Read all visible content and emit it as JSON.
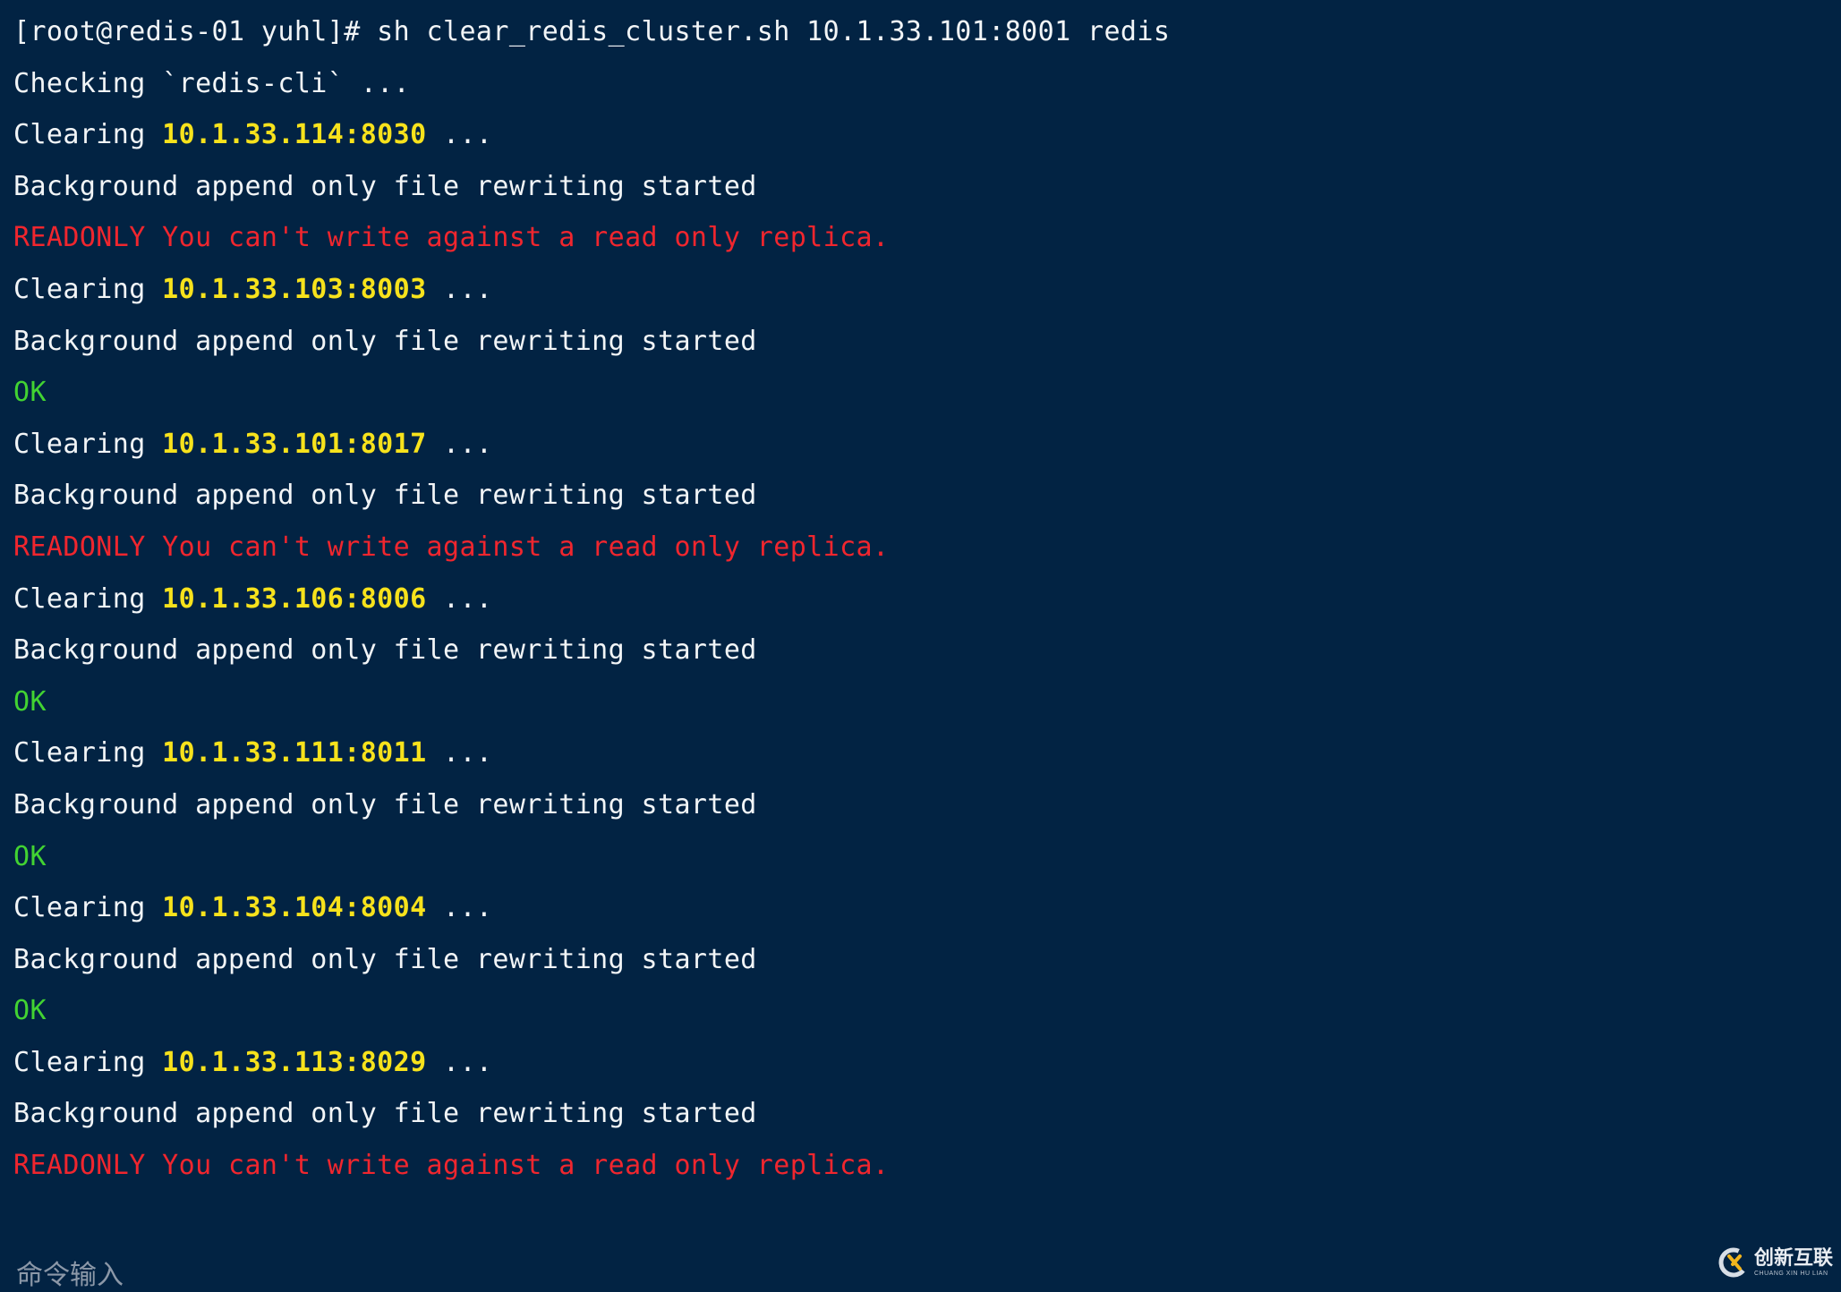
{
  "terminal": {
    "prompt": "[root@redis-01 yuhl]# ",
    "command": "sh clear_redis_cluster.sh 10.1.33.101:8001 redis",
    "lines": [
      {
        "type": "prompt",
        "segments": [
          {
            "text": "[root@redis-01 yuhl]# sh clear_redis_cluster.sh 10.1.33.101:8001 redis",
            "color": "white"
          }
        ]
      },
      {
        "type": "info",
        "segments": [
          {
            "text": "Checking `redis-cli` ...",
            "color": "white"
          }
        ]
      },
      {
        "type": "clearing",
        "segments": [
          {
            "text": "Clearing ",
            "color": "white"
          },
          {
            "text": "10.1.33.114:8030",
            "color": "yellow"
          },
          {
            "text": " ...",
            "color": "white"
          }
        ]
      },
      {
        "type": "info",
        "segments": [
          {
            "text": "Background append only file rewriting started",
            "color": "white"
          }
        ]
      },
      {
        "type": "error",
        "segments": [
          {
            "text": "READONLY You can't write against a read only replica.",
            "color": "red"
          }
        ]
      },
      {
        "type": "clearing",
        "segments": [
          {
            "text": "Clearing ",
            "color": "white"
          },
          {
            "text": "10.1.33.103:8003",
            "color": "yellow"
          },
          {
            "text": " ...",
            "color": "white"
          }
        ]
      },
      {
        "type": "info",
        "segments": [
          {
            "text": "Background append only file rewriting started",
            "color": "white"
          }
        ]
      },
      {
        "type": "ok",
        "segments": [
          {
            "text": "OK",
            "color": "green"
          }
        ]
      },
      {
        "type": "clearing",
        "segments": [
          {
            "text": "Clearing ",
            "color": "white"
          },
          {
            "text": "10.1.33.101:8017",
            "color": "yellow"
          },
          {
            "text": " ...",
            "color": "white"
          }
        ]
      },
      {
        "type": "info",
        "segments": [
          {
            "text": "Background append only file rewriting started",
            "color": "white"
          }
        ]
      },
      {
        "type": "error",
        "segments": [
          {
            "text": "READONLY You can't write against a read only replica.",
            "color": "red"
          }
        ]
      },
      {
        "type": "clearing",
        "segments": [
          {
            "text": "Clearing ",
            "color": "white"
          },
          {
            "text": "10.1.33.106:8006",
            "color": "yellow"
          },
          {
            "text": " ...",
            "color": "white"
          }
        ]
      },
      {
        "type": "info",
        "segments": [
          {
            "text": "Background append only file rewriting started",
            "color": "white"
          }
        ]
      },
      {
        "type": "ok",
        "segments": [
          {
            "text": "OK",
            "color": "green"
          }
        ]
      },
      {
        "type": "clearing",
        "segments": [
          {
            "text": "Clearing ",
            "color": "white"
          },
          {
            "text": "10.1.33.111:8011",
            "color": "yellow"
          },
          {
            "text": " ...",
            "color": "white"
          }
        ]
      },
      {
        "type": "info",
        "segments": [
          {
            "text": "Background append only file rewriting started",
            "color": "white"
          }
        ]
      },
      {
        "type": "ok",
        "segments": [
          {
            "text": "OK",
            "color": "green"
          }
        ]
      },
      {
        "type": "clearing",
        "segments": [
          {
            "text": "Clearing ",
            "color": "white"
          },
          {
            "text": "10.1.33.104:8004",
            "color": "yellow"
          },
          {
            "text": " ...",
            "color": "white"
          }
        ]
      },
      {
        "type": "info",
        "segments": [
          {
            "text": "Background append only file rewriting started",
            "color": "white"
          }
        ]
      },
      {
        "type": "ok",
        "segments": [
          {
            "text": "OK",
            "color": "green"
          }
        ]
      },
      {
        "type": "clearing",
        "segments": [
          {
            "text": "Clearing ",
            "color": "white"
          },
          {
            "text": "10.1.33.113:8029",
            "color": "yellow"
          },
          {
            "text": " ...",
            "color": "white"
          }
        ]
      },
      {
        "type": "info",
        "segments": [
          {
            "text": "Background append only file rewriting started",
            "color": "white"
          }
        ]
      },
      {
        "type": "error",
        "segments": [
          {
            "text": "READONLY You can't write against a read only replica.",
            "color": "red"
          }
        ]
      }
    ],
    "input_placeholder": "命令输入"
  },
  "watermark": {
    "brand_cn": "创新互联",
    "brand_en": "CHUANG XIN HU LIAN",
    "logo_icon": "cx-logo-icon"
  },
  "colors": {
    "background": "#022343",
    "text": "#f2f5f7",
    "highlight": "#f7e21c",
    "error": "#f0262e",
    "success": "#42d332",
    "placeholder": "#8c98a8"
  }
}
